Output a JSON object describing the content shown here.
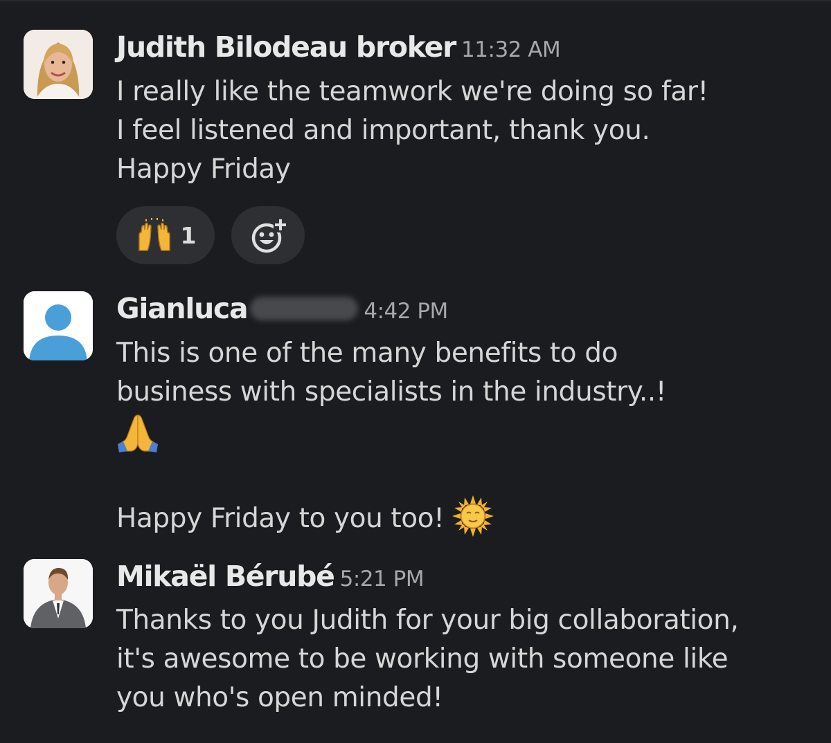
{
  "messages": [
    {
      "author": "Judith Bilodeau broker",
      "time": "11:32 AM",
      "avatar_icon": "profile-photo-woman",
      "lines": [
        "I really like the teamwork we're doing so far!",
        "I feel listened and important, thank you.",
        "Happy Friday"
      ],
      "reactions": [
        {
          "emoji": "raising-hands",
          "count": "1"
        }
      ],
      "add_reaction_icon": "add-reaction-icon"
    },
    {
      "author": "Gianluca",
      "author_redacted": true,
      "time": "4:42 PM",
      "avatar_icon": "default-user-avatar",
      "lines": [
        "This is one of the many benefits to do",
        "business with specialists in the industry..!"
      ],
      "emoji_line": "folded-hands",
      "closing_line": "Happy Friday to you too!",
      "closing_emoji": "sun-with-face"
    },
    {
      "author": "Mikaël Bérubé",
      "time": "5:21 PM",
      "avatar_icon": "profile-photo-man",
      "lines": [
        "Thanks to you Judith for your big collaboration,",
        "it's awesome to be working with someone like",
        "you who's open minded!"
      ]
    }
  ],
  "colors": {
    "background": "#1b1c1f",
    "reaction_pill": "#2e2f33",
    "text": "#d6d6d6",
    "author": "#e8e8e8",
    "time": "#a7a8aa",
    "default_avatar_blue": "#4a9fd8"
  }
}
